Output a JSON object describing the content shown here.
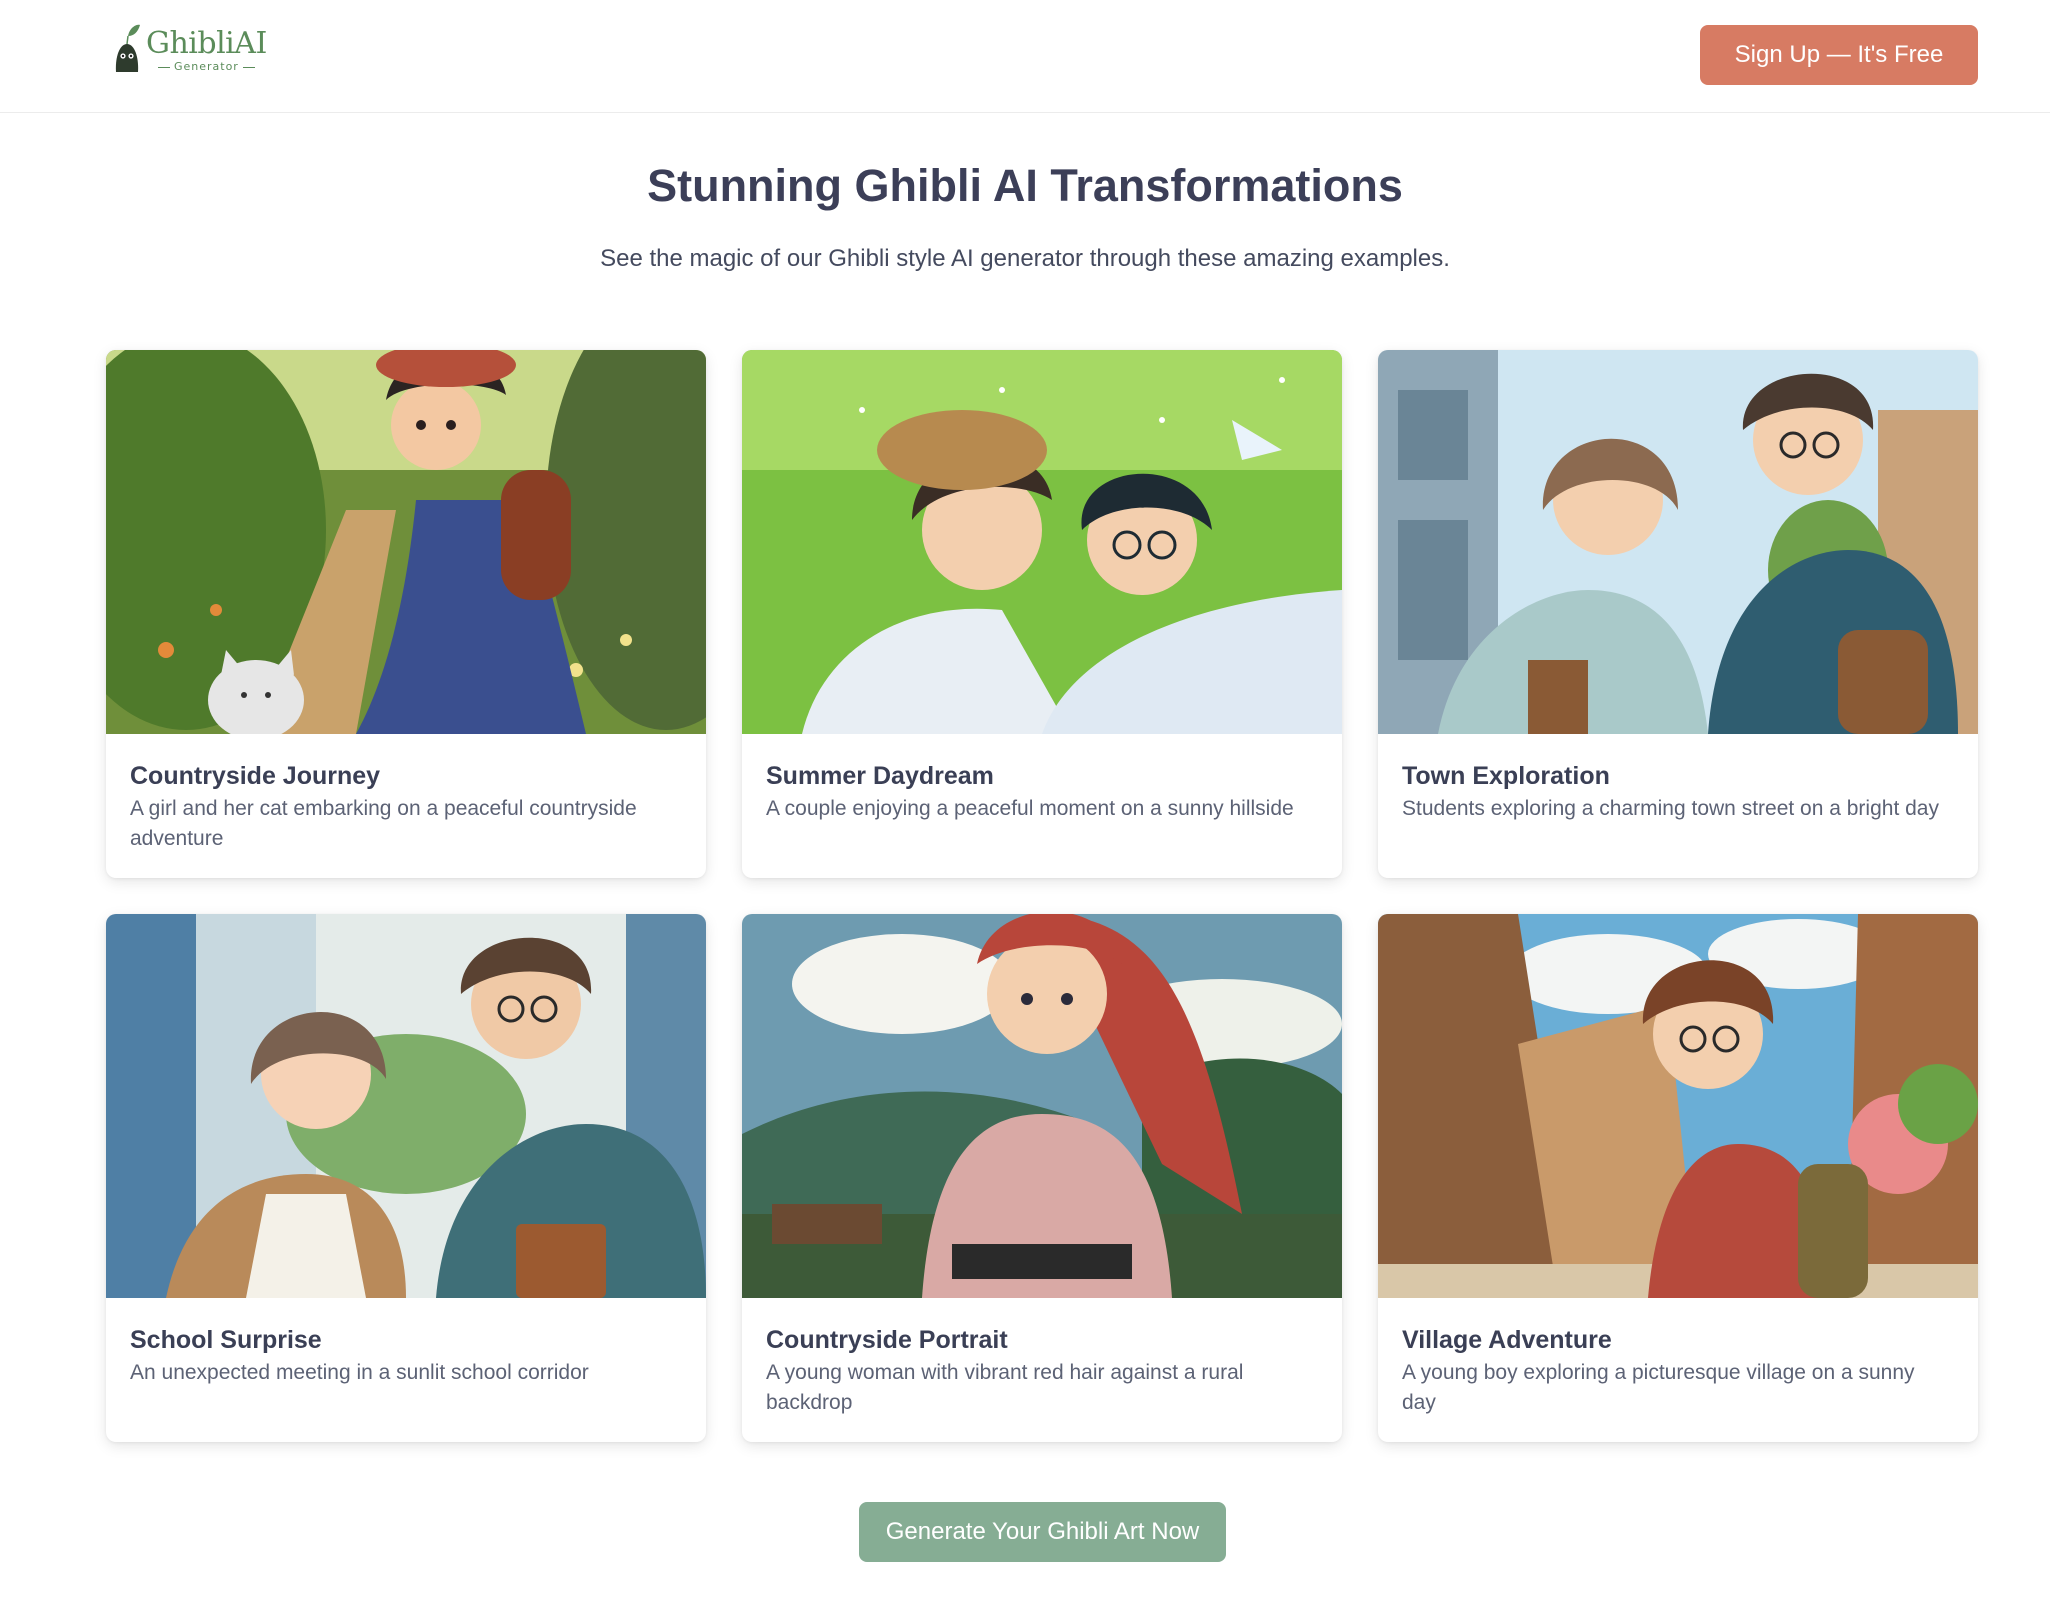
{
  "header": {
    "logo_name": "GhibliAI",
    "logo_sub": "Generator",
    "signup_label": "Sign Up — It's Free"
  },
  "hero": {
    "title": "Stunning Ghibli AI Transformations",
    "subtitle": "See the magic of our Ghibli style AI generator through these amazing examples."
  },
  "gallery": [
    {
      "title": "Countryside Journey",
      "description": "A girl and her cat embarking on a peaceful countryside adventure"
    },
    {
      "title": "Summer Daydream",
      "description": "A couple enjoying a peaceful moment on a sunny hillside"
    },
    {
      "title": "Town Exploration",
      "description": "Students exploring a charming town street on a bright day"
    },
    {
      "title": "School Surprise",
      "description": "An unexpected meeting in a sunlit school corridor"
    },
    {
      "title": "Countryside Portrait",
      "description": "A young woman with vibrant red hair against a rural backdrop"
    },
    {
      "title": "Village Adventure",
      "description": "A young boy exploring a picturesque village on a sunny day"
    }
  ],
  "cta": {
    "label": "Generate Your Ghibli Art Now"
  },
  "colors": {
    "brand_green": "#5b8c5a",
    "signup_bg": "#d77b63",
    "cta_bg": "#86ad94",
    "heading": "#3c3f58"
  }
}
